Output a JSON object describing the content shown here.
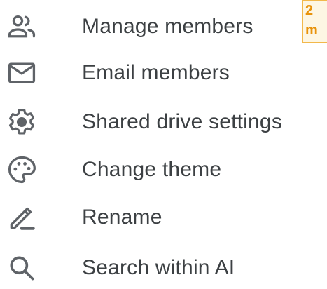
{
  "menu": {
    "items": [
      {
        "label": "Manage members",
        "icon": "manage-members-icon"
      },
      {
        "label": "Email members",
        "icon": "email-icon"
      },
      {
        "label": "Shared drive settings",
        "icon": "settings-gear-icon"
      },
      {
        "label": "Change theme",
        "icon": "palette-icon"
      },
      {
        "label": "Rename",
        "icon": "rename-pencil-icon"
      },
      {
        "label": "Search within AI",
        "icon": "search-icon"
      }
    ]
  },
  "tooltip": {
    "line1": "2",
    "line2": "m"
  },
  "colors": {
    "text": "#3c4043",
    "icon": "#5f6368",
    "tooltip_border": "#f2b84b",
    "tooltip_text": "#e8930c"
  }
}
